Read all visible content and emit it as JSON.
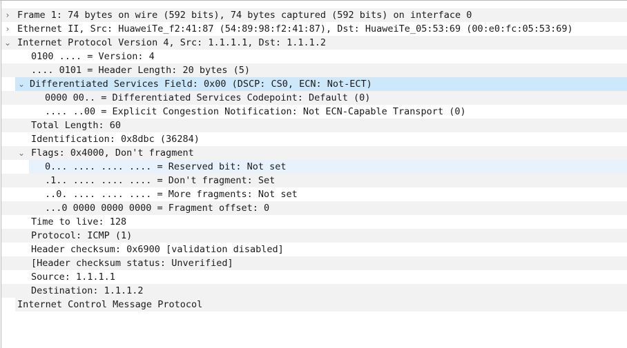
{
  "tree": [
    {
      "text": "Frame 1: 74 bytes on wire (592 bits), 74 bytes captured (592 bits) on interface 0",
      "expander": "›"
    },
    {
      "text": "Ethernet II, Src: HuaweiTe_f2:41:87 (54:89:98:f2:41:87), Dst: HuaweiTe_05:53:69 (00:e0:fc:05:53:69)",
      "expander": "›"
    },
    {
      "text": "Internet Protocol Version 4, Src: 1.1.1.1, Dst: 1.1.1.2",
      "expander": "⌄"
    },
    {
      "text": "0100 .... = Version: 4"
    },
    {
      "text": ".... 0101 = Header Length: 20 bytes (5)"
    },
    {
      "text": "Differentiated Services Field: 0x00 (DSCP: CS0, ECN: Not-ECT)",
      "expander": "⌄"
    },
    {
      "text": "0000 00.. = Differentiated Services Codepoint: Default (0)"
    },
    {
      "text": ".... ..00 = Explicit Congestion Notification: Not ECN-Capable Transport (0)"
    },
    {
      "text": "Total Length: 60"
    },
    {
      "text": "Identification: 0x8dbc (36284)"
    },
    {
      "text": "Flags: 0x4000, Don't fragment",
      "expander": "⌄"
    },
    {
      "text": "0... .... .... .... = Reserved bit: Not set"
    },
    {
      "text": ".1.. .... .... .... = Don't fragment: Set"
    },
    {
      "text": "..0. .... .... .... = More fragments: Not set"
    },
    {
      "text": "...0 0000 0000 0000 = Fragment offset: 0"
    },
    {
      "text": "Time to live: 128"
    },
    {
      "text": "Protocol: ICMP (1)"
    },
    {
      "text": "Header checksum: 0x6900 [validation disabled]"
    },
    {
      "text": "[Header checksum status: Unverified]"
    },
    {
      "text": "Source: 1.1.1.1"
    },
    {
      "text": "Destination: 1.1.1.2"
    },
    {
      "text": "Internet Control Message Protocol",
      "expander": "›"
    }
  ]
}
